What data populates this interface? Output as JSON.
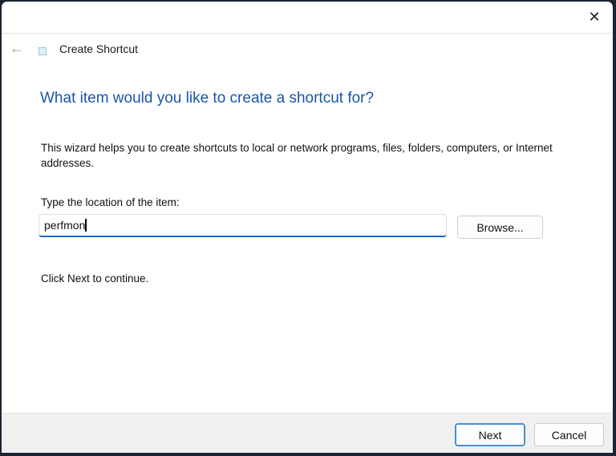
{
  "window": {
    "title": "Create Shortcut",
    "close_icon": "close-icon",
    "back_icon": "arrow-left-icon"
  },
  "main": {
    "heading": "What item would you like to create a shortcut for?",
    "description": "This wizard helps you to create shortcuts to local or network programs, files, folders, computers, or Internet addresses.",
    "location_label": "Type the location of the item:",
    "location_value": "perfmon",
    "browse_label": "Browse...",
    "continue_text": "Click Next to continue."
  },
  "footer": {
    "next_label": "Next",
    "cancel_label": "Cancel"
  }
}
